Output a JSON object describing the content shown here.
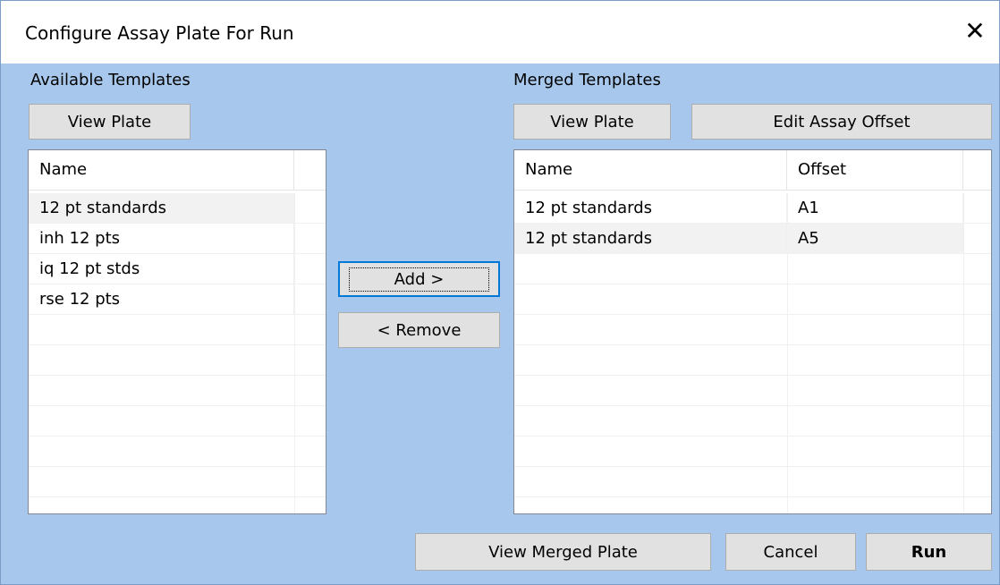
{
  "window": {
    "title": "Configure Assay Plate For Run"
  },
  "available": {
    "label": "Available Templates",
    "view_plate": "View Plate",
    "column_name": "Name",
    "items": [
      "12 pt standards",
      "inh 12 pts",
      "iq 12 pt stds",
      "rse 12 pts"
    ]
  },
  "middle": {
    "add": "Add >",
    "remove": "< Remove"
  },
  "merged": {
    "label": "Merged Templates",
    "view_plate": "View Plate",
    "edit_offset": "Edit Assay Offset",
    "column_name": "Name",
    "column_offset": "Offset",
    "rows": [
      {
        "name": "12 pt standards",
        "offset": "A1"
      },
      {
        "name": "12 pt standards",
        "offset": "A5"
      }
    ]
  },
  "footer": {
    "view_merged": "View Merged Plate",
    "cancel": "Cancel",
    "run": "Run"
  }
}
